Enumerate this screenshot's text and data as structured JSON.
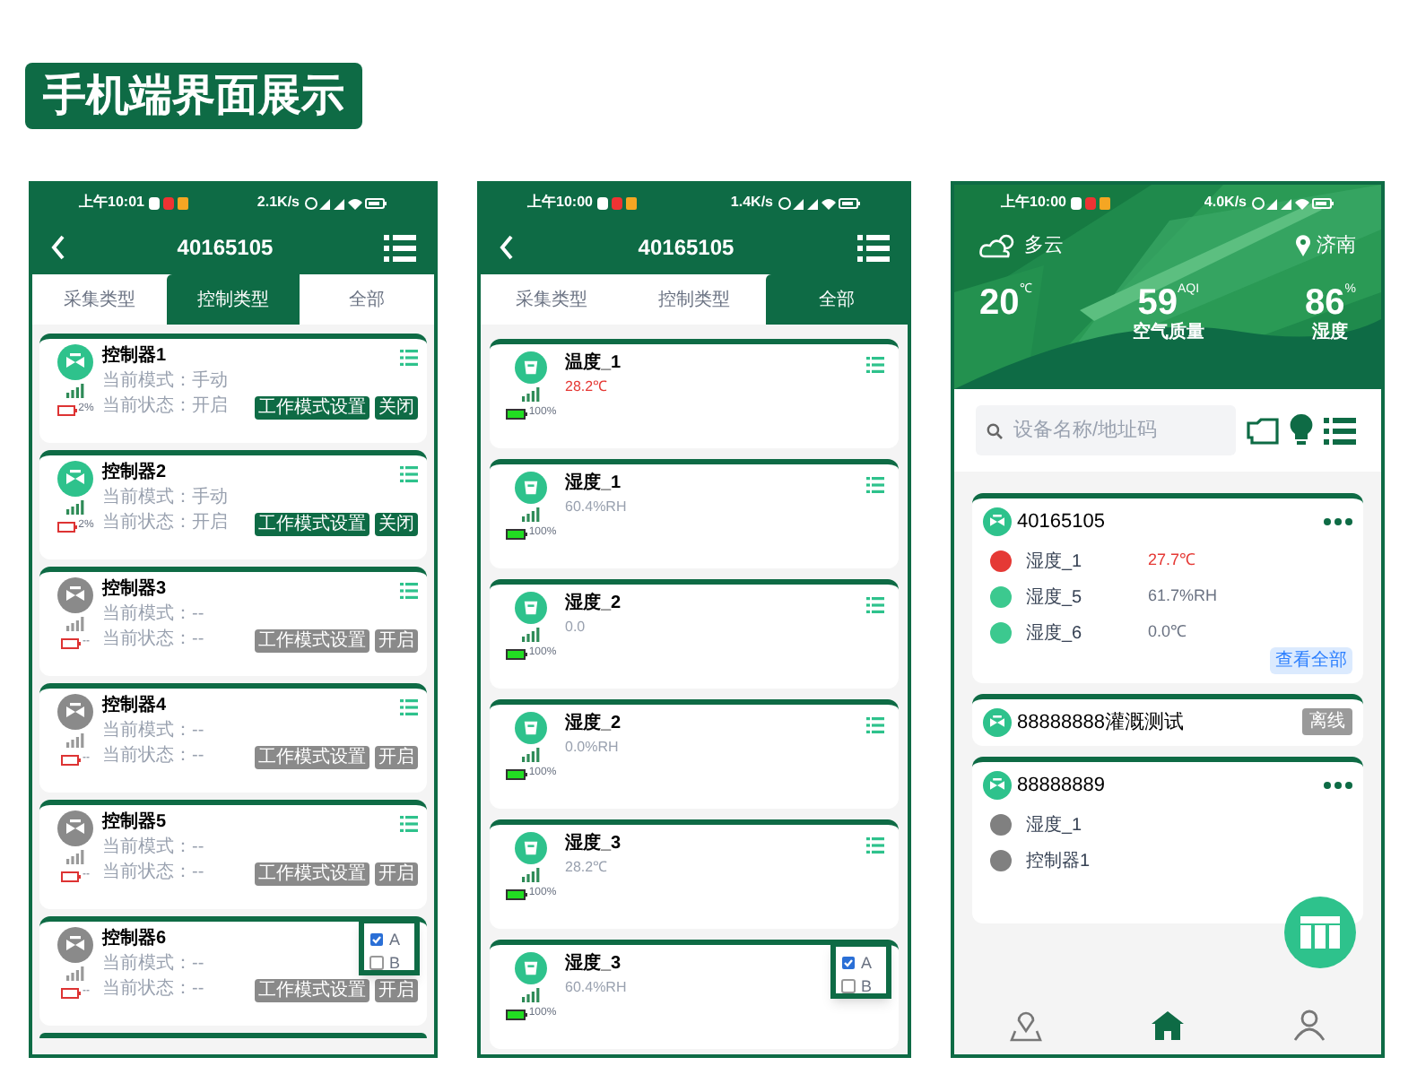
{
  "title_badge": "手机端界面展示",
  "phone_1": {
    "status_bar": {
      "time": "上午10:01",
      "speed": "2.1K/s"
    },
    "title": "40165105",
    "tabs": [
      {
        "label": "采集类型",
        "selected": false
      },
      {
        "label": "控制类型",
        "selected": true
      },
      {
        "label": "全部",
        "selected": false
      }
    ],
    "cards": [
      {
        "name": "控制器1",
        "mode": "当前模式：手动",
        "state": "当前状态：开启",
        "battery": "2%",
        "online": true,
        "buttons": [
          "工作模式设置",
          "关闭"
        ]
      },
      {
        "name": "控制器2",
        "mode": "当前模式：手动",
        "state": "当前状态：开启",
        "battery": "2%",
        "online": true,
        "buttons": [
          "工作模式设置",
          "关闭"
        ]
      },
      {
        "name": "控制器3",
        "mode": "当前模式：--",
        "state": "当前状态：--",
        "battery": "--",
        "online": false,
        "buttons": [
          "工作模式设置",
          "开启"
        ]
      },
      {
        "name": "控制器4",
        "mode": "当前模式：--",
        "state": "当前状态：--",
        "battery": "--",
        "online": false,
        "buttons": [
          "工作模式设置",
          "开启"
        ]
      },
      {
        "name": "控制器5",
        "mode": "当前模式：--",
        "state": "当前状态：--",
        "battery": "--",
        "online": false,
        "buttons": [
          "工作模式设置",
          "开启"
        ]
      },
      {
        "name": "控制器6",
        "mode": "当前模式：--",
        "state": "当前状态：--",
        "battery": "--",
        "online": false,
        "buttons": [
          "工作模式设置",
          "开启"
        ]
      }
    ],
    "popup": {
      "options": [
        {
          "label": "A",
          "checked": true
        },
        {
          "label": "B",
          "checked": false
        }
      ]
    }
  },
  "phone_2": {
    "status_bar": {
      "time": "上午10:00",
      "speed": "1.4K/s"
    },
    "title": "40165105",
    "tabs": [
      {
        "label": "采集类型",
        "selected": false
      },
      {
        "label": "控制类型",
        "selected": false
      },
      {
        "label": "全部",
        "selected": true
      }
    ],
    "cards": [
      {
        "name": "温度_1",
        "reading": "28.2℃",
        "alarm": true,
        "battery": "100%"
      },
      {
        "name": "湿度_1",
        "reading": "60.4%RH",
        "alarm": false,
        "battery": "100%"
      },
      {
        "name": "湿度_2",
        "reading": "0.0",
        "alarm": false,
        "battery": "100%"
      },
      {
        "name": "湿度_2",
        "reading": "0.0%RH",
        "alarm": false,
        "battery": "100%"
      },
      {
        "name": "湿度_3",
        "reading": "28.2℃",
        "alarm": false,
        "battery": "100%"
      },
      {
        "name": "湿度_3",
        "reading": "60.4%RH",
        "alarm": false,
        "battery": "100%"
      }
    ],
    "popup": {
      "options": [
        {
          "label": "A",
          "checked": true
        },
        {
          "label": "B",
          "checked": false
        }
      ]
    }
  },
  "phone_3": {
    "status_bar": {
      "time": "上午10:00",
      "speed": "4.0K/s"
    },
    "weather": "多云",
    "location": "济南",
    "stats": [
      {
        "value": "20",
        "unit": "℃"
      },
      {
        "value": "59",
        "unit": "AQI",
        "label": "空气质量"
      },
      {
        "value": "86",
        "unit": "%",
        "label": "湿度"
      }
    ],
    "search": {
      "placeholder": "设备名称/地址码"
    },
    "devices": [
      {
        "kind": "list",
        "id": "40165105",
        "items": [
          {
            "name": "湿度_1",
            "reading": "27.7℃",
            "alarm": true,
            "color": "#e53935"
          },
          {
            "name": "湿度_5",
            "reading": "61.7%RH",
            "alarm": false,
            "color": "#3cc98f"
          },
          {
            "name": "湿度_6",
            "reading": "0.0℃",
            "alarm": false,
            "color": "#3cc98f"
          }
        ],
        "link": "查看全部"
      },
      {
        "kind": "offline",
        "id": "88888888灌溉测试",
        "badge": "离线"
      },
      {
        "kind": "list",
        "id": "88888889",
        "items": [
          {
            "name": "湿度_1",
            "color": "#808080"
          },
          {
            "name": "控制器1",
            "color": "#808080"
          }
        ]
      }
    ],
    "nav": [
      {
        "selected": false
      },
      {
        "selected": true
      },
      {
        "selected": false
      }
    ]
  }
}
